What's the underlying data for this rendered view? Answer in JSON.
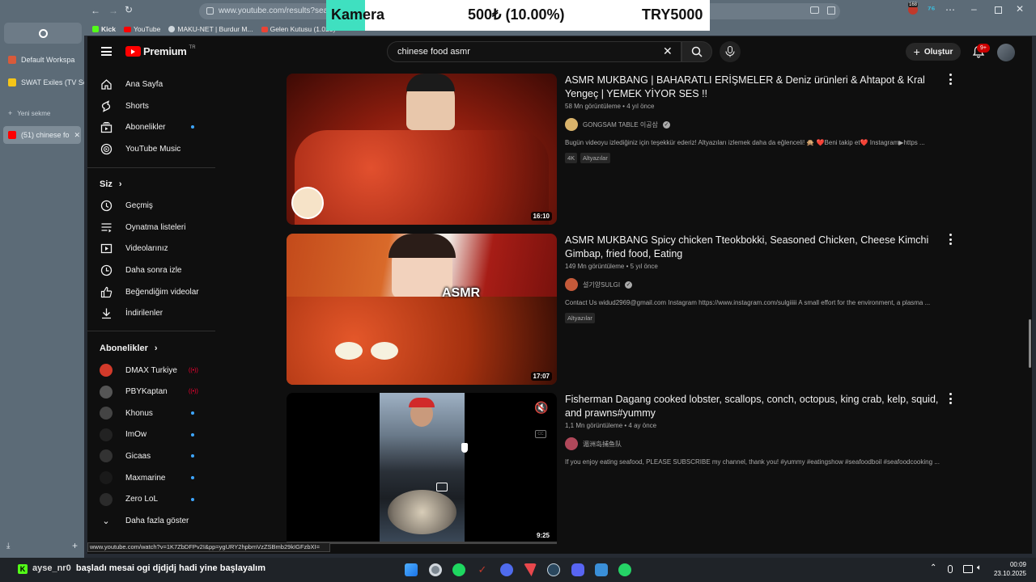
{
  "browser": {
    "url": "www.youtube.com/results?search",
    "workspace": "Default Workspa",
    "tabs": [
      {
        "label": "SWAT Exiles (TV Se"
      },
      {
        "label": "Yeni sekme"
      },
      {
        "label": "(51) chinese fo"
      }
    ],
    "bookmarks": [
      "Kick",
      "YouTube",
      "MAKU-NET | Burdur M...",
      "Gelen Kutusu (1.020) -"
    ],
    "ext_badge": "168",
    "status_url": "www.youtube.com/watch?v=1K7ZbDFPv2I&pp=ygURY2hpbmVzZSBmb29kIGFzbXI="
  },
  "overlay": {
    "label": "Kamera",
    "amount": "500₺ (10.00%)",
    "goal": "TRY5000"
  },
  "youtube": {
    "logo_text": "Premium",
    "logo_region": "TR",
    "search_value": "chinese food asmr",
    "create_label": "Oluştur",
    "notif_badge": "9+",
    "guide": {
      "main": [
        "Ana Sayfa",
        "Shorts",
        "Abonelikler",
        "YouTube Music"
      ],
      "you_header": "Siz",
      "you": [
        "Geçmiş",
        "Oynatma listeleri",
        "Videolarınız",
        "Daha sonra izle",
        "Beğendiğim videolar",
        "İndirilenler"
      ],
      "subs_header": "Abonelikler",
      "subs": [
        {
          "name": "DMAX Turkiye",
          "status": "live",
          "color": "#d23a2a"
        },
        {
          "name": "PBYKaptan",
          "status": "live",
          "color": "#555555"
        },
        {
          "name": "Khonus",
          "status": "new",
          "color": "#444444"
        },
        {
          "name": "ImOw",
          "status": "new",
          "color": "#222222"
        },
        {
          "name": "Gicaas",
          "status": "new",
          "color": "#333333"
        },
        {
          "name": "Maxmarine",
          "status": "new",
          "color": "#1a1a1a"
        },
        {
          "name": "Zero LoL",
          "status": "new",
          "color": "#2b2b2b"
        }
      ],
      "more": "Daha fazla göster",
      "live_glyph": "((•))"
    },
    "results": [
      {
        "title": "ASMR MUKBANG | BAHARATLI ERİŞMELER & Deniz ürünleri & Ahtapot & Kral Yengeç | YEMEK YİYOR SES !!",
        "views": "58 Mn görüntüleme",
        "age": "4 yıl önce",
        "channel": "GONGSAM TABLE 이공삼",
        "description": "Bugün videoyu izlediğiniz için teşekkür ederiz! Altyazıları izlemek daha da eğlenceli! 🙊 ❤️Beni takip et❤️ Instagram▶https ...",
        "tags": [
          "4K",
          "Altyazılar"
        ],
        "duration": "16:10"
      },
      {
        "title": "ASMR MUKBANG Spicy chicken Tteokbokki, Seasoned Chicken, Cheese Kimchi Gimbap, fried food, Eating",
        "views": "149 Mn görüntüleme",
        "age": "5 yıl önce",
        "channel": "설기양SULGI",
        "description": "Contact Us widud2969@gmail.com Instagram https://www.instagram.com/sulgiiiii A small effort for the environment, a plasma ...",
        "tags": [
          "Altyazılar"
        ],
        "duration": "17:07",
        "overlay_text": "ASMR"
      },
      {
        "title": "Fisherman Dagang cooked lobster, scallops, conch, octopus, king crab, kelp, squid, and prawns#yummy",
        "views": "1,1 Mn görüntüleme",
        "age": "4 ay önce",
        "channel": "湄洲岛捕鱼队",
        "description": "If you enjoy eating seafood, PLEASE SUBSCRIBE my channel, thank you! #yummy #eatingshow #seafoodboil #seafoodcooking ...",
        "tags": [],
        "duration": "9:25"
      }
    ]
  },
  "taskbar": {
    "chat_user": "ayse_nr0",
    "chat_message": "başladı mesai ogi djdjdj hadi yine başlayalım",
    "time": "00:09",
    "date": "23.10.2025"
  },
  "colors": {
    "yt_bg": "#0f0f0f",
    "yt_red": "#ff0000",
    "browser_chrome": "#5c6b77",
    "live": "#ff0033",
    "new_dot": "#3ea6ff"
  }
}
